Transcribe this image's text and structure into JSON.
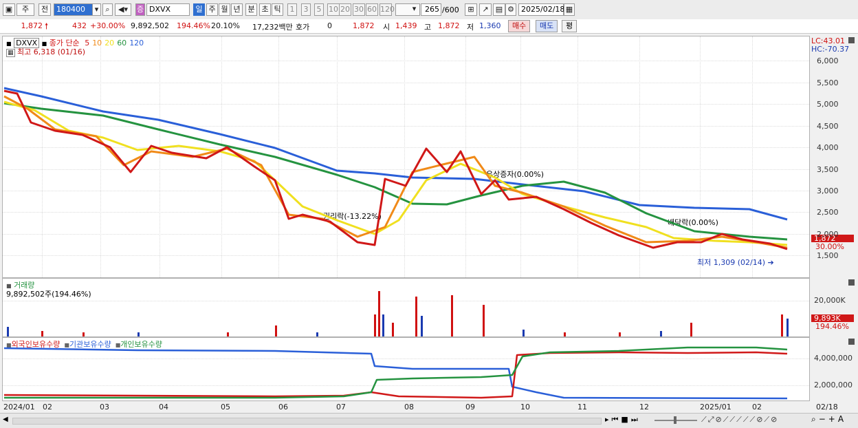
{
  "toolbar": {
    "type1": "주",
    "type2": "전",
    "code": "180400",
    "stock_prefix": "증",
    "stock_name": "DXVX",
    "periods": [
      "일",
      "주",
      "월",
      "년",
      "분",
      "초",
      "틱"
    ],
    "period_selected": 0,
    "intervals": [
      "1",
      "3",
      "5",
      "10",
      "20",
      "30",
      "60",
      "120"
    ],
    "count": "265",
    "count_max": "/600",
    "date": "2025/02/18"
  },
  "quote": {
    "price": "1,872",
    "change": "432",
    "change_rate": "+30.00%",
    "volume": "9,892,502",
    "volume_rate": "194.46%",
    "turnover": "20.10%",
    "amount": "17,232백만",
    "hoga_label": "호가",
    "hoga_value": "0",
    "price2": "1,872",
    "open_label": "시",
    "open": "1,439",
    "high_label": "고",
    "high": "1,872",
    "low_label": "저",
    "low": "1,360",
    "buy": "매수",
    "sell": "매도",
    "eval": "평"
  },
  "price_panel": {
    "symbol": "DXVX",
    "legend_prefix": "종가 단순",
    "ma_periods": [
      "5",
      "10",
      "20",
      "60",
      "120"
    ],
    "ma_colors": [
      "#d01818",
      "#f08a18",
      "#f0e020",
      "#259340",
      "#2a5fd8"
    ],
    "high_note": "최고 6,318 (01/16)",
    "low_note": "최저 1,309 (02/14)",
    "annotations": [
      "권리락(-13.22%)",
      "유상증자(0.00%)",
      "배당락(0.00%)"
    ],
    "lc": "LC:43.01",
    "hc": "HC:-70.37",
    "y_ticks": [
      "6,000",
      "5,500",
      "5,000",
      "4,500",
      "4,000",
      "3,500",
      "3,000",
      "2,500",
      "2,000",
      "1,500"
    ],
    "last_price": "1,872",
    "last_pct": "30.00%"
  },
  "volume_panel": {
    "title": "거래량",
    "value": "9,892,502주(194.46%)",
    "y_ticks": [
      "20,000K"
    ],
    "last_value": "9,893K",
    "last_pct": "194.46%"
  },
  "holding_panel": {
    "legend": [
      "외국인보유수량",
      "기관보유수량",
      "개인보유수량"
    ],
    "legend_colors": [
      "#d01818",
      "#2a5fd8",
      "#259340"
    ],
    "y_ticks": [
      "4,000,000",
      "2,000,000"
    ]
  },
  "x_axis": [
    "2024/01",
    "02",
    "03",
    "04",
    "05",
    "06",
    "07",
    "08",
    "09",
    "10",
    "11",
    "12",
    "2025/01",
    "02"
  ],
  "x_right": "02/18",
  "colors": {
    "up": "#d01010",
    "down": "#1a3ab0",
    "accent": "#2f6fd0"
  }
}
